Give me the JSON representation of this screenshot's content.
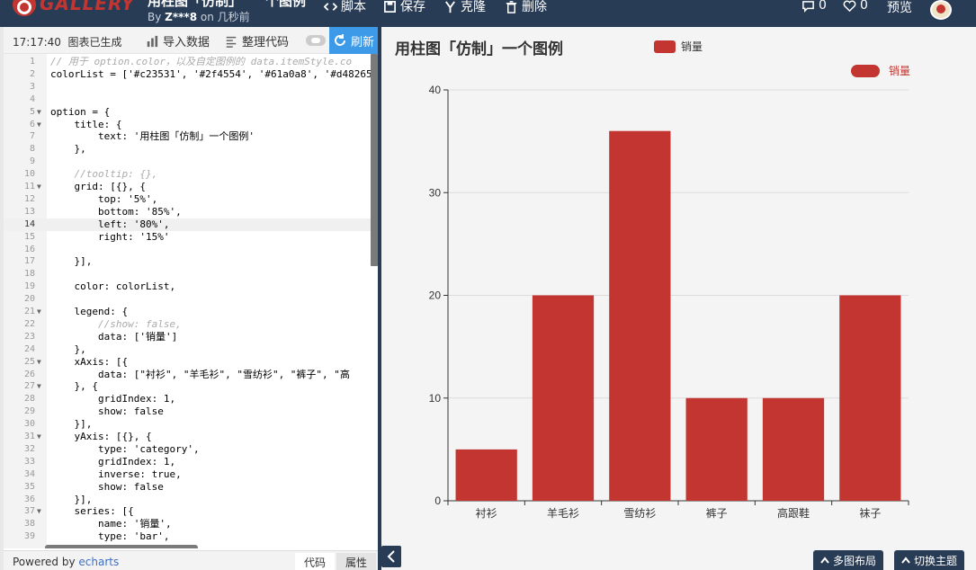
{
  "navbar": {
    "logo_text": "GALLERY",
    "title": "用柱图「仿制」",
    "title_suffix": "个图例",
    "author_prefix": "By",
    "author": "Z***8",
    "author_suffix": "on 几秒前",
    "script_label": "脚本",
    "save_label": "保存",
    "fork_label": "克隆",
    "delete_label": "删除",
    "comment_count": "0",
    "like_count": "0",
    "preview_label": "预览"
  },
  "toolbar": {
    "time": "17:17:40",
    "status": "图表已生成",
    "import_label": "导入数据",
    "format_label": "整理代码",
    "refresh_label": "刷新"
  },
  "editor": {
    "lines": [
      "// 用于 option.color，以及自定图例的 data.itemStyle.co",
      "colorList = ['#c23531', '#2f4554', '#61a0a8', '#d48265",
      "",
      "",
      "option = {",
      "    title: {",
      "        text: '用柱图「仿制」一个图例'",
      "    },",
      "",
      "    //tooltip: {},",
      "    grid: [{}, {",
      "        top: '5%',",
      "        bottom: '85%',",
      "        left: '80%',",
      "        right: '15%'",
      "",
      "    }],",
      "",
      "    color: colorList,",
      "",
      "    legend: {",
      "        //show: false,",
      "        data: ['销量']",
      "    },",
      "    xAxis: [{",
      "        data: [\"衬衫\", \"羊毛衫\", \"雪纺衫\", \"裤子\", \"高",
      "    }, {",
      "        gridIndex: 1,",
      "        show: false",
      "    }],",
      "    yAxis: [{}, {",
      "        type: 'category',",
      "        gridIndex: 1,",
      "        inverse: true,",
      "        show: false",
      "    }],",
      "    series: [{",
      "        name: '销量',",
      "        type: 'bar',"
    ]
  },
  "footer": {
    "powered_prefix": "Powered by",
    "powered_link": "echarts",
    "tab_code": "代码",
    "tab_props": "属性"
  },
  "chart_buttons": {
    "multi_layout": "多图布局",
    "switch_theme": "切换主题"
  },
  "chart_data": {
    "type": "bar",
    "title": "用柱图「仿制」一个图例",
    "categories": [
      "衬衫",
      "羊毛衫",
      "雪纺衫",
      "裤子",
      "高跟鞋",
      "袜子"
    ],
    "series": [
      {
        "name": "销量",
        "values": [
          5,
          20,
          36,
          10,
          10,
          20
        ]
      }
    ],
    "ylim": [
      0,
      40
    ],
    "yticks": [
      0,
      10,
      20,
      30,
      40
    ],
    "grid": true,
    "legend": "top-center",
    "custom_legend": {
      "label": "销量",
      "placement": "top-right"
    },
    "colors": {
      "bar": "#c23531"
    }
  }
}
